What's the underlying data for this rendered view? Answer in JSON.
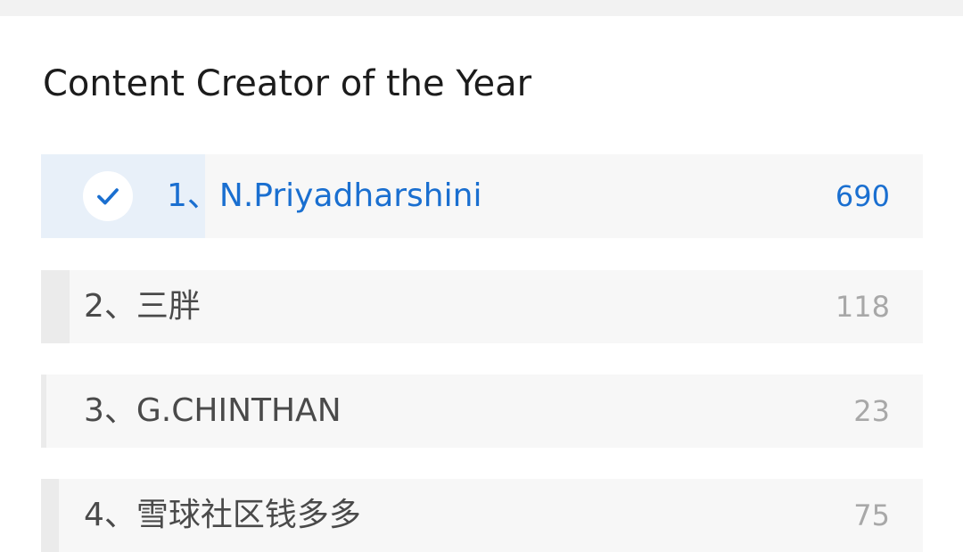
{
  "poll": {
    "title": "Content Creator of the Year",
    "options": [
      {
        "rank": "1、",
        "name": "N.Priyadharshini",
        "votes": "690",
        "share": 0.186,
        "selected": true
      },
      {
        "rank": "2、",
        "name": "三胖",
        "votes": "118",
        "share": 0.032,
        "selected": false
      },
      {
        "rank": "3、",
        "name": "G.CHINTHAN",
        "votes": "23",
        "share": 0.006,
        "selected": false
      },
      {
        "rank": "4、",
        "name": "雪球社区钱多多",
        "votes": "75",
        "share": 0.02,
        "selected": false
      }
    ]
  },
  "icons": {
    "selected_mark": "check-icon"
  },
  "colors": {
    "accent": "#1a6fd0",
    "selected_fill": "#e8f0f9",
    "option_bg": "#f7f7f7",
    "option_fill": "#ebebeb",
    "title": "#1c1c1c",
    "label": "#4a4a4a",
    "count": "#a8a8a8"
  }
}
